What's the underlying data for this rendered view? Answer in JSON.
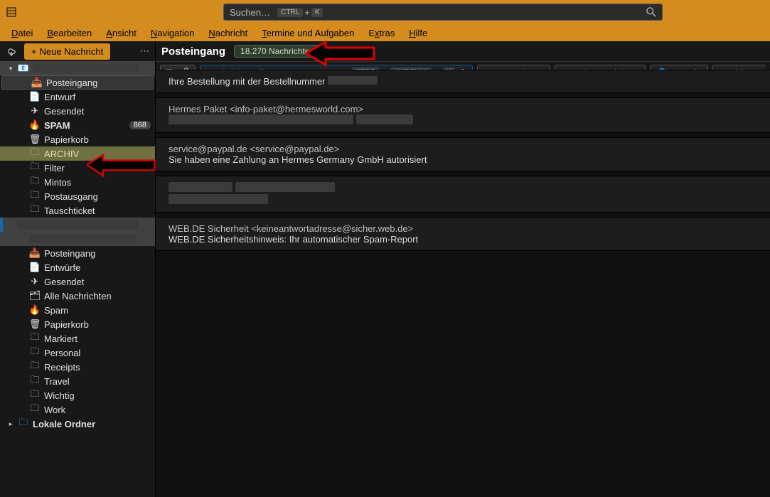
{
  "titlebar": {
    "search_placeholder": "Suchen…",
    "kbd1": "CTRL",
    "kbd_plus": "+",
    "kbd2": "K"
  },
  "menubar": [
    "Datei",
    "Bearbeiten",
    "Ansicht",
    "Navigation",
    "Nachricht",
    "Termine und Aufgaben",
    "Extras",
    "Hilfe"
  ],
  "menubar_underline_idx": [
    0,
    0,
    0,
    0,
    0,
    0,
    1,
    0
  ],
  "sidebar_toolbar": {
    "new_msg": "Neue Nachricht"
  },
  "account1": {
    "folders": [
      {
        "icon": "inbox",
        "label": "Posteingang",
        "sel": true
      },
      {
        "icon": "draft",
        "label": "Entwurf"
      },
      {
        "icon": "sent",
        "label": "Gesendet"
      },
      {
        "icon": "spam",
        "label": "SPAM",
        "badge": "868",
        "spam": true
      },
      {
        "icon": "trash",
        "label": "Papierkorb"
      },
      {
        "icon": "folder",
        "label": "ARCHIV",
        "archiv": true
      },
      {
        "icon": "folder",
        "label": "Filter"
      },
      {
        "icon": "folder",
        "label": "Mintos"
      },
      {
        "icon": "folder",
        "label": "Postausgang"
      },
      {
        "icon": "folder",
        "label": "Tauschticket"
      }
    ]
  },
  "account2": {
    "folders": [
      {
        "icon": "inbox",
        "label": "Posteingang"
      },
      {
        "icon": "draft",
        "label": "Entwürfe"
      },
      {
        "icon": "sent",
        "label": "Gesendet"
      },
      {
        "icon": "all",
        "label": "Alle Nachrichten"
      },
      {
        "icon": "spam",
        "label": "Spam"
      },
      {
        "icon": "trash",
        "label": "Papierkorb"
      },
      {
        "icon": "folder",
        "label": "Markiert"
      },
      {
        "icon": "folder",
        "label": "Personal"
      },
      {
        "icon": "folder",
        "label": "Receipts"
      },
      {
        "icon": "folder",
        "label": "Travel"
      },
      {
        "icon": "folder",
        "label": "Wichtig"
      },
      {
        "icon": "folder",
        "label": "Work"
      }
    ]
  },
  "local_folders_label": "Lokale Ordner",
  "tabs": {
    "title": "Posteingang",
    "count": "18.270 Nachrichten"
  },
  "filterbar": {
    "placeholder": "Nachrichten filtern…",
    "k1": "STRG",
    "k_plus": "+",
    "k2": "UMSCHAL",
    "k3": "K",
    "qf_unread": "Ungelesen",
    "qf_star": "Gekennzeichnet",
    "qf_contact": "Kontakt",
    "qf_tag": "Schlagw"
  },
  "messages": [
    {
      "from": "",
      "subject": ""
    },
    {
      "from": "Hermes Paket <info-paket@hermesworld.com>",
      "subject": ""
    },
    {
      "from": "service@paypal.de <service@paypal.de>",
      "subject": "Sie haben eine Zahlung an Hermes Germany GmbH autorisiert"
    },
    {
      "from": "",
      "subject": ""
    },
    {
      "from": "WEB.DE Sicherheit <keineantwortadresse@sicher.web.de>",
      "subject": "WEB.DE Sicherheitshinweis: Ihr automatischer Spam-Report"
    }
  ],
  "partial_subject_0": "Ihre Bestellung mit der Bestellnummer"
}
